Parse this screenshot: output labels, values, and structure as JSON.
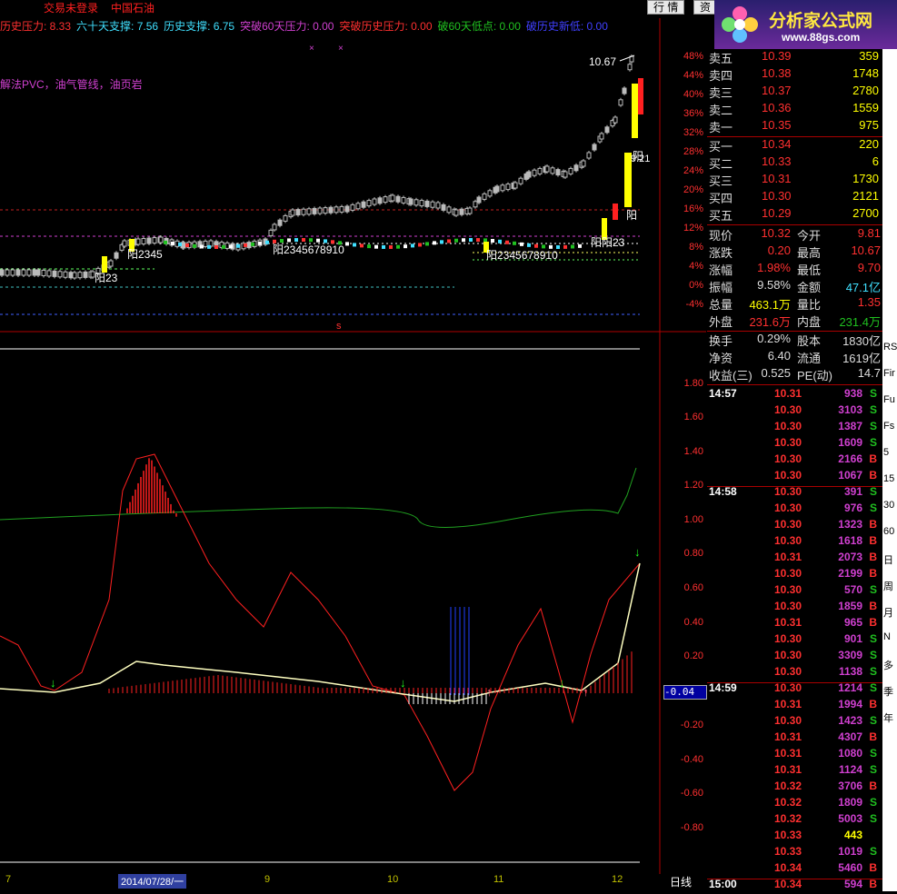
{
  "topbar": {
    "title": "交易未登录",
    "stock_name": "中国石油",
    "btn_trade": "行 情",
    "btn_info": "资"
  },
  "logo": {
    "main": "分析家公式网",
    "url": "www.88gs.com"
  },
  "indicators": [
    {
      "label": "历史压力: 8.33",
      "color": "#ff3030"
    },
    {
      "label": "六十天支撑: 7.56",
      "color": "#40e0ff"
    },
    {
      "label": "历史支撑: 6.75",
      "color": "#40e0ff"
    },
    {
      "label": "突破60天压力: 0.00",
      "color": "#d040d0"
    },
    {
      "label": "突破历史压力: 0.00",
      "color": "#ff3030"
    },
    {
      "label": "破60天低点: 0.00",
      "color": "#20c020"
    },
    {
      "label": "破历史新低: 0.00",
      "color": "#4040ff"
    }
  ],
  "note": "解法PVC，油气管线，油页岩",
  "price_axis": [
    "48%",
    "44%",
    "40%",
    "36%",
    "32%",
    "28%",
    "24%",
    "20%",
    "16%",
    "12%",
    "8%",
    "4%",
    "0%",
    "-4%"
  ],
  "osc_axis": [
    "1.80",
    "1.60",
    "1.40",
    "1.20",
    "1.00",
    "0.80",
    "0.60",
    "0.40",
    "0.20",
    "-0.20",
    "-0.40",
    "-0.60",
    "-0.80"
  ],
  "osc_current": "-0.04",
  "chart_labels": {
    "high_price": "10.67",
    "cursor_price": "9.21",
    "yang1": "阳23",
    "yang2": "阳2345",
    "yang3": "阳2345678910",
    "yang4": "阳2345678910",
    "yang5": "阳阳23",
    "yang6": "阳",
    "yang7": "阳",
    "marker_s": "s"
  },
  "dates": {
    "d1": "7",
    "cursor": "2014/07/28/一",
    "d2": "9",
    "d3": "10",
    "d4": "11",
    "d5": "12"
  },
  "period": "日线",
  "orderbook": {
    "sell": [
      {
        "label": "卖五",
        "price": "10.39",
        "vol": "359"
      },
      {
        "label": "卖四",
        "price": "10.38",
        "vol": "1748"
      },
      {
        "label": "卖三",
        "price": "10.37",
        "vol": "2780"
      },
      {
        "label": "卖二",
        "price": "10.36",
        "vol": "1559"
      },
      {
        "label": "卖一",
        "price": "10.35",
        "vol": "975"
      }
    ],
    "buy": [
      {
        "label": "买一",
        "price": "10.34",
        "vol": "220"
      },
      {
        "label": "买二",
        "price": "10.33",
        "vol": "6"
      },
      {
        "label": "买三",
        "price": "10.31",
        "vol": "1730"
      },
      {
        "label": "买四",
        "price": "10.30",
        "vol": "2121"
      },
      {
        "label": "买五",
        "price": "10.29",
        "vol": "2700"
      }
    ]
  },
  "stats": [
    {
      "l1": "现价",
      "v1": "10.32",
      "c1": "#ff3030",
      "l2": "今开",
      "v2": "9.81",
      "c2": "#ff3030"
    },
    {
      "l1": "涨跌",
      "v1": "0.20",
      "c1": "#ff3030",
      "l2": "最高",
      "v2": "10.67",
      "c2": "#ff3030"
    },
    {
      "l1": "涨幅",
      "v1": "1.98%",
      "c1": "#ff3030",
      "l2": "最低",
      "v2": "9.70",
      "c2": "#ff3030"
    },
    {
      "l1": "振幅",
      "v1": "9.58%",
      "c1": "#dddddd",
      "l2": "金额",
      "v2": "47.1亿",
      "c2": "#40e0ff"
    },
    {
      "l1": "总量",
      "v1": "463.1万",
      "c1": "#ffff00",
      "l2": "量比",
      "v2": "1.35",
      "c2": "#ff3030"
    },
    {
      "l1": "外盘",
      "v1": "231.6万",
      "c1": "#ff3030",
      "l2": "内盘",
      "v2": "231.4万",
      "c2": "#20c020"
    },
    {
      "l1": "换手",
      "v1": "0.29%",
      "c1": "#dddddd",
      "l2": "股本",
      "v2": "1830亿",
      "c2": "#dddddd"
    },
    {
      "l1": "净资",
      "v1": "6.40",
      "c1": "#dddddd",
      "l2": "流通",
      "v2": "1619亿",
      "c2": "#dddddd"
    },
    {
      "l1": "收益(三)",
      "v1": "0.525",
      "c1": "#dddddd",
      "l2": "PE(动)",
      "v2": "14.7",
      "c2": "#dddddd"
    }
  ],
  "ticks": [
    {
      "t": "14:57",
      "p": "10.31",
      "v": "938",
      "s": "S"
    },
    {
      "t": "",
      "p": "10.30",
      "v": "3103",
      "s": "S"
    },
    {
      "t": "",
      "p": "10.30",
      "v": "1387",
      "s": "S"
    },
    {
      "t": "",
      "p": "10.30",
      "v": "1609",
      "s": "S"
    },
    {
      "t": "",
      "p": "10.30",
      "v": "2166",
      "s": "B"
    },
    {
      "t": "",
      "p": "10.30",
      "v": "1067",
      "s": "B"
    },
    {
      "t": "14:58",
      "p": "10.30",
      "v": "391",
      "s": "S"
    },
    {
      "t": "",
      "p": "10.30",
      "v": "976",
      "s": "S"
    },
    {
      "t": "",
      "p": "10.30",
      "v": "1323",
      "s": "B"
    },
    {
      "t": "",
      "p": "10.30",
      "v": "1618",
      "s": "B"
    },
    {
      "t": "",
      "p": "10.31",
      "v": "2073",
      "s": "B"
    },
    {
      "t": "",
      "p": "10.30",
      "v": "2199",
      "s": "B"
    },
    {
      "t": "",
      "p": "10.30",
      "v": "570",
      "s": "S"
    },
    {
      "t": "",
      "p": "10.30",
      "v": "1859",
      "s": "B"
    },
    {
      "t": "",
      "p": "10.31",
      "v": "965",
      "s": "B"
    },
    {
      "t": "",
      "p": "10.30",
      "v": "901",
      "s": "S"
    },
    {
      "t": "",
      "p": "10.30",
      "v": "3309",
      "s": "S"
    },
    {
      "t": "",
      "p": "10.30",
      "v": "1138",
      "s": "S"
    },
    {
      "t": "14:59",
      "p": "10.30",
      "v": "1214",
      "s": "S"
    },
    {
      "t": "",
      "p": "10.31",
      "v": "1994",
      "s": "B"
    },
    {
      "t": "",
      "p": "10.30",
      "v": "1423",
      "s": "S"
    },
    {
      "t": "",
      "p": "10.31",
      "v": "4307",
      "s": "B"
    },
    {
      "t": "",
      "p": "10.31",
      "v": "1080",
      "s": "S"
    },
    {
      "t": "",
      "p": "10.31",
      "v": "1124",
      "s": "S"
    },
    {
      "t": "",
      "p": "10.32",
      "v": "3706",
      "s": "B"
    },
    {
      "t": "",
      "p": "10.32",
      "v": "1809",
      "s": "S"
    },
    {
      "t": "",
      "p": "10.32",
      "v": "5003",
      "s": "S"
    },
    {
      "t": "",
      "p": "10.33",
      "v": "443",
      "s": ""
    },
    {
      "t": "",
      "p": "10.33",
      "v": "1019",
      "s": "S"
    },
    {
      "t": "",
      "p": "10.34",
      "v": "5460",
      "s": "B"
    },
    {
      "t": "15:00",
      "p": "10.34",
      "v": "594",
      "s": "B"
    }
  ],
  "sidebar_labels": [
    "RS",
    "Fir",
    "Fu",
    "Fs",
    "5",
    "15",
    "30",
    "60",
    "日",
    "周",
    "月",
    "N",
    "多",
    "季",
    "年"
  ]
}
